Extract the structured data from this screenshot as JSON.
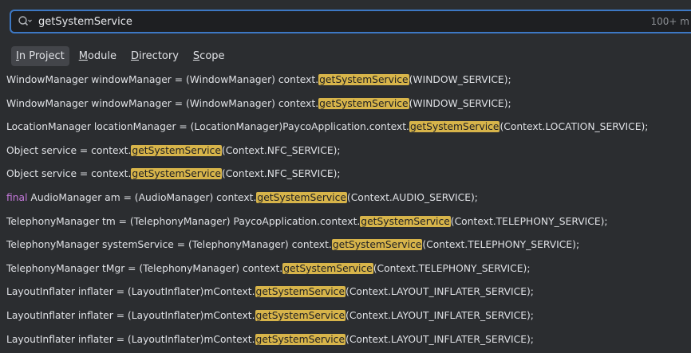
{
  "search": {
    "query": "getSystemService",
    "match_count": "100+ m"
  },
  "tabs": [
    {
      "mnemonic": "I",
      "rest": "n Project",
      "selected": true
    },
    {
      "mnemonic": "M",
      "rest": "odule",
      "selected": false
    },
    {
      "mnemonic": "D",
      "rest": "irectory",
      "selected": false
    },
    {
      "mnemonic": "S",
      "rest": "cope",
      "selected": false
    }
  ],
  "results": [
    {
      "keyword": "",
      "before": "WindowManager windowManager = (WindowManager) context.",
      "match": "getSystemService",
      "after": "(WINDOW_SERVICE);"
    },
    {
      "keyword": "",
      "before": "WindowManager windowManager = (WindowManager) context.",
      "match": "getSystemService",
      "after": "(WINDOW_SERVICE);"
    },
    {
      "keyword": "",
      "before": "LocationManager locationManager = (LocationManager)PaycoApplication.context.",
      "match": "getSystemService",
      "after": "(Context.LOCATION_SERVICE);"
    },
    {
      "keyword": "",
      "before": "Object service = context.",
      "match": "getSystemService",
      "after": "(Context.NFC_SERVICE);"
    },
    {
      "keyword": "",
      "before": "Object service = context.",
      "match": "getSystemService",
      "after": "(Context.NFC_SERVICE);"
    },
    {
      "keyword": "final",
      "before": " AudioManager am = (AudioManager) context.",
      "match": "getSystemService",
      "after": "(Context.AUDIO_SERVICE);"
    },
    {
      "keyword": "",
      "before": "TelephonyManager tm = (TelephonyManager) PaycoApplication.context.",
      "match": "getSystemService",
      "after": "(Context.TELEPHONY_SERVICE);"
    },
    {
      "keyword": "",
      "before": "TelephonyManager systemService = (TelephonyManager) context.",
      "match": "getSystemService",
      "after": "(Context.TELEPHONY_SERVICE);"
    },
    {
      "keyword": "",
      "before": "TelephonyManager tMgr = (TelephonyManager) context.",
      "match": "getSystemService",
      "after": "(Context.TELEPHONY_SERVICE);"
    },
    {
      "keyword": "",
      "before": "LayoutInflater inflater = (LayoutInflater)mContext.",
      "match": "getSystemService",
      "after": "(Context.LAYOUT_INFLATER_SERVICE);"
    },
    {
      "keyword": "",
      "before": "LayoutInflater inflater = (LayoutInflater)mContext.",
      "match": "getSystemService",
      "after": "(Context.LAYOUT_INFLATER_SERVICE);"
    },
    {
      "keyword": "",
      "before": "LayoutInflater inflater = (LayoutInflater)mContext.",
      "match": "getSystemService",
      "after": "(Context.LAYOUT_INFLATER_SERVICE);"
    }
  ]
}
